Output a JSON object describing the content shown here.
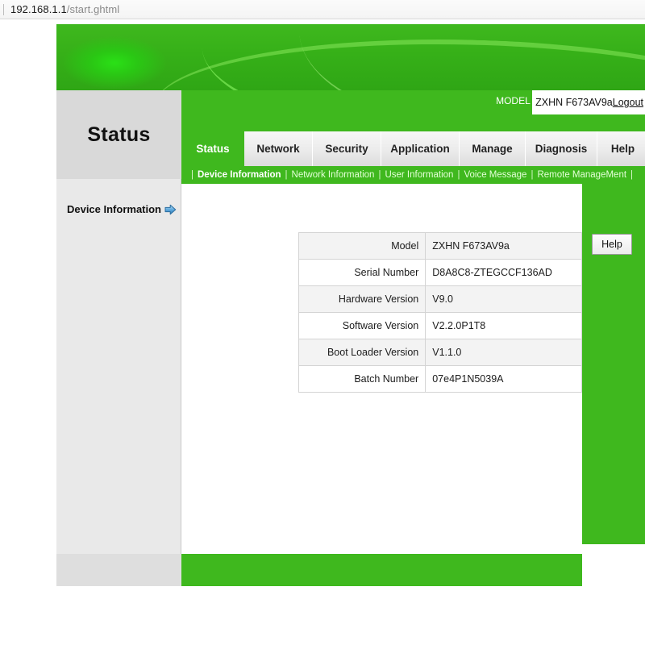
{
  "browser": {
    "url_host": "192.168.1.1",
    "url_path": "/start.ghtml"
  },
  "header": {
    "model_label": "MODEL :",
    "model_value": "ZXHN F673AV9a",
    "logout_label": "Logout",
    "section_title": "Status"
  },
  "tabs": [
    {
      "label": "Status",
      "active": true
    },
    {
      "label": "Network",
      "active": false
    },
    {
      "label": "Security",
      "active": false
    },
    {
      "label": "Application",
      "active": false
    },
    {
      "label": "Manage",
      "active": false
    },
    {
      "label": "Diagnosis",
      "active": false
    },
    {
      "label": "Help",
      "active": false
    }
  ],
  "subnav": [
    {
      "label": "Device Information",
      "active": true
    },
    {
      "label": "Network Information",
      "active": false
    },
    {
      "label": "User Information",
      "active": false
    },
    {
      "label": "Voice Message",
      "active": false
    },
    {
      "label": "Remote ManageMent",
      "active": false
    }
  ],
  "sidebar": {
    "items": [
      {
        "label": "Device Information",
        "icon": "blue-right-arrow-icon"
      }
    ]
  },
  "right_panel": {
    "help_label": "Help"
  },
  "device_information": {
    "rows": [
      {
        "key": "Model",
        "value": "ZXHN F673AV9a"
      },
      {
        "key": "Serial Number",
        "value": "D8A8C8-ZTEGCCF136AD"
      },
      {
        "key": "Hardware Version",
        "value": "V9.0"
      },
      {
        "key": "Software Version",
        "value": "V2.2.0P1T8"
      },
      {
        "key": "Boot Loader Version",
        "value": "V1.1.0"
      },
      {
        "key": "Batch Number",
        "value": "07e4P1N5039A"
      }
    ]
  },
  "colors": {
    "brand_green": "#3fb81e",
    "banner_glow": "#2ae016",
    "panel_gray": "#d9d9d9",
    "sidebar_gray": "#e9e9e9",
    "row_alt": "#f3f3f3"
  }
}
